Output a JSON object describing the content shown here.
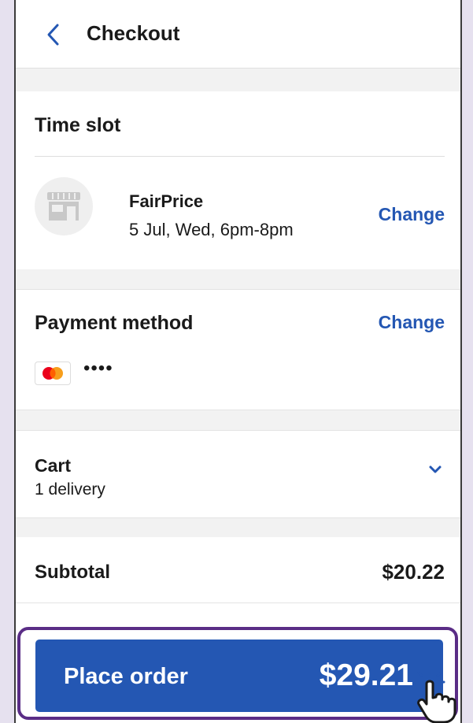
{
  "header": {
    "title": "Checkout",
    "back_icon": "chevron-left-icon"
  },
  "time_slot": {
    "title": "Time slot",
    "store_name": "FairPrice",
    "slot": "5 Jul, Wed, 6pm-8pm",
    "change_label": "Change",
    "store_icon": "store-icon"
  },
  "payment": {
    "title": "Payment method",
    "change_label": "Change",
    "card_brand_icon": "mastercard-icon",
    "card_masked": "••••"
  },
  "cart": {
    "title": "Cart",
    "subtitle": "1 delivery",
    "expand_icon": "chevron-down-icon"
  },
  "summary": {
    "subtotal_label": "Subtotal",
    "subtotal_value": "$20.22"
  },
  "place_order": {
    "label": "Place order",
    "amount": "$29.21"
  },
  "colors": {
    "accent": "#2457b3",
    "highlight": "#5a2d86",
    "background": "#e6e1ef",
    "mastercard_red": "#eb001b",
    "mastercard_orange": "#f79e1b"
  }
}
